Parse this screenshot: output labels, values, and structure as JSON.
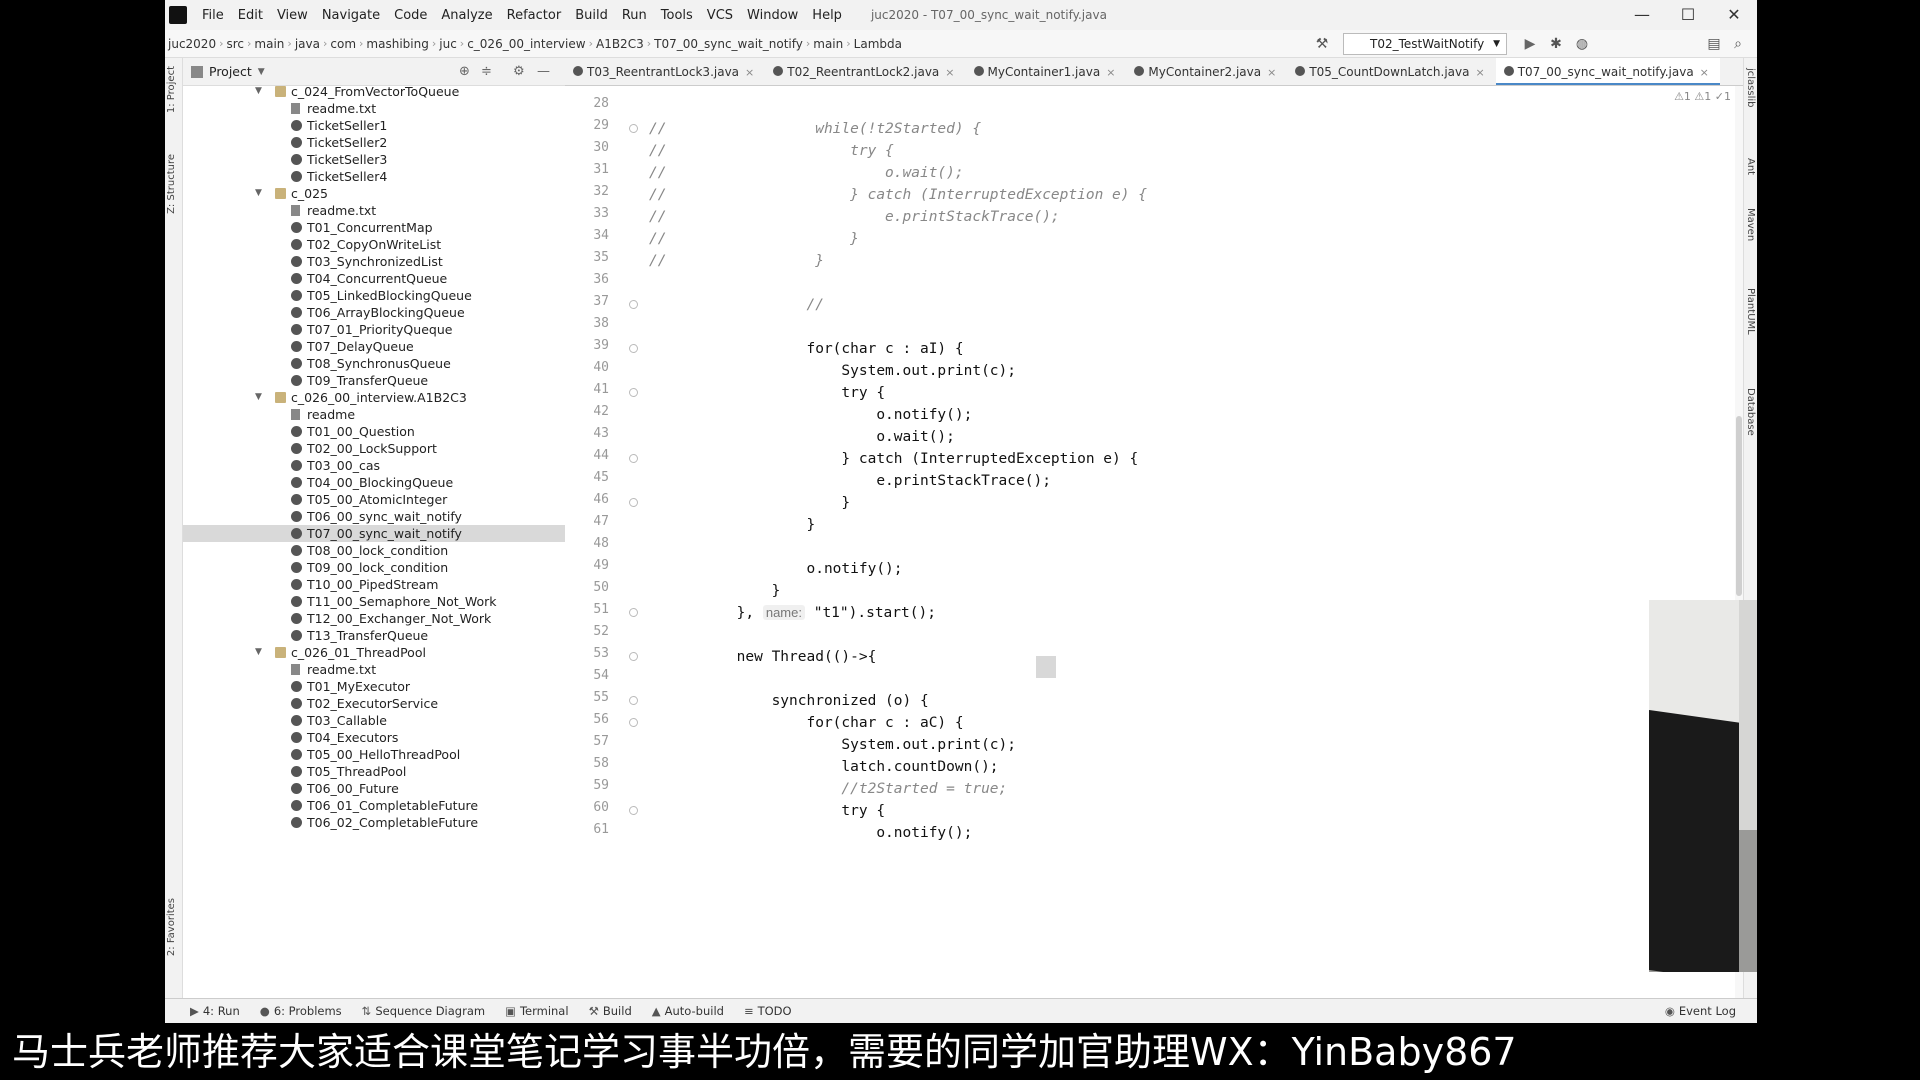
{
  "menu": {
    "items": [
      "File",
      "Edit",
      "View",
      "Navigate",
      "Code",
      "Analyze",
      "Refactor",
      "Build",
      "Run",
      "Tools",
      "VCS",
      "Window",
      "Help"
    ],
    "window_title": "juc2020 - T07_00_sync_wait_notify.java"
  },
  "window_controls": {
    "minimize": "—",
    "maximize": "☐",
    "close": "✕"
  },
  "breadcrumbs": [
    "juc2020",
    "src",
    "main",
    "java",
    "com",
    "mashibing",
    "juc",
    "c_026_00_interview",
    "A1B2C3",
    "T07_00_sync_wait_notify",
    "main",
    "Lambda"
  ],
  "run_config": "T02_TestWaitNotify",
  "project_panel": {
    "title": "Project"
  },
  "left_strip": {
    "project": "1: Project",
    "structure": "Z: Structure",
    "favorites": "2: Favorites"
  },
  "right_strip": {
    "jclasslib": "jclasslib",
    "ant": "Ant",
    "maven": "Maven",
    "plantuml": "PlantUML",
    "database": "Database"
  },
  "tree": [
    {
      "label": "c_024_FromVectorToQueue",
      "kind": "pkg",
      "depth": 1,
      "expanded": true
    },
    {
      "label": "readme.txt",
      "kind": "txt",
      "depth": 2
    },
    {
      "label": "TicketSeller1",
      "kind": "java",
      "depth": 2
    },
    {
      "label": "TicketSeller2",
      "kind": "java",
      "depth": 2
    },
    {
      "label": "TicketSeller3",
      "kind": "java",
      "depth": 2
    },
    {
      "label": "TicketSeller4",
      "kind": "java",
      "depth": 2
    },
    {
      "label": "c_025",
      "kind": "pkg",
      "depth": 1,
      "expanded": true
    },
    {
      "label": "readme.txt",
      "kind": "txt",
      "depth": 2
    },
    {
      "label": "T01_ConcurrentMap",
      "kind": "java",
      "depth": 2
    },
    {
      "label": "T02_CopyOnWriteList",
      "kind": "java",
      "depth": 2
    },
    {
      "label": "T03_SynchronizedList",
      "kind": "java",
      "depth": 2
    },
    {
      "label": "T04_ConcurrentQueue",
      "kind": "java",
      "depth": 2
    },
    {
      "label": "T05_LinkedBlockingQueue",
      "kind": "java",
      "depth": 2
    },
    {
      "label": "T06_ArrayBlockingQueue",
      "kind": "java",
      "depth": 2
    },
    {
      "label": "T07_01_PriorityQueque",
      "kind": "java",
      "depth": 2
    },
    {
      "label": "T07_DelayQueue",
      "kind": "java",
      "depth": 2
    },
    {
      "label": "T08_SynchronusQueue",
      "kind": "java",
      "depth": 2
    },
    {
      "label": "T09_TransferQueue",
      "kind": "java",
      "depth": 2
    },
    {
      "label": "c_026_00_interview.A1B2C3",
      "kind": "pkg",
      "depth": 1,
      "expanded": true
    },
    {
      "label": "readme",
      "kind": "txt",
      "depth": 2
    },
    {
      "label": "T01_00_Question",
      "kind": "java",
      "depth": 2
    },
    {
      "label": "T02_00_LockSupport",
      "kind": "java",
      "depth": 2
    },
    {
      "label": "T03_00_cas",
      "kind": "java",
      "depth": 2
    },
    {
      "label": "T04_00_BlockingQueue",
      "kind": "java",
      "depth": 2
    },
    {
      "label": "T05_00_AtomicInteger",
      "kind": "java",
      "depth": 2
    },
    {
      "label": "T06_00_sync_wait_notify",
      "kind": "java",
      "depth": 2
    },
    {
      "label": "T07_00_sync_wait_notify",
      "kind": "java",
      "depth": 2,
      "selected": true
    },
    {
      "label": "T08_00_lock_condition",
      "kind": "java",
      "depth": 2
    },
    {
      "label": "T09_00_lock_condition",
      "kind": "java",
      "depth": 2
    },
    {
      "label": "T10_00_PipedStream",
      "kind": "java",
      "depth": 2
    },
    {
      "label": "T11_00_Semaphore_Not_Work",
      "kind": "java",
      "depth": 2
    },
    {
      "label": "T12_00_Exchanger_Not_Work",
      "kind": "java",
      "depth": 2
    },
    {
      "label": "T13_TransferQueue",
      "kind": "java",
      "depth": 2
    },
    {
      "label": "c_026_01_ThreadPool",
      "kind": "pkg",
      "depth": 1,
      "expanded": true
    },
    {
      "label": "readme.txt",
      "kind": "txt",
      "depth": 2
    },
    {
      "label": "T01_MyExecutor",
      "kind": "java",
      "depth": 2
    },
    {
      "label": "T02_ExecutorService",
      "kind": "java",
      "depth": 2
    },
    {
      "label": "T03_Callable",
      "kind": "java",
      "depth": 2
    },
    {
      "label": "T04_Executors",
      "kind": "java",
      "depth": 2
    },
    {
      "label": "T05_00_HelloThreadPool",
      "kind": "java",
      "depth": 2
    },
    {
      "label": "T05_ThreadPool",
      "kind": "java",
      "depth": 2
    },
    {
      "label": "T06_00_Future",
      "kind": "java",
      "depth": 2
    },
    {
      "label": "T06_01_CompletableFuture",
      "kind": "java",
      "depth": 2
    },
    {
      "label": "T06_02_CompletableFuture",
      "kind": "java",
      "depth": 2
    }
  ],
  "editor_tabs": [
    {
      "label": "T03_ReentrantLock3.java"
    },
    {
      "label": "T02_ReentrantLock2.java"
    },
    {
      "label": "MyContainer1.java"
    },
    {
      "label": "MyContainer2.java"
    },
    {
      "label": "T05_CountDownLatch.java"
    },
    {
      "label": "T07_00_sync_wait_notify.java",
      "active": true
    }
  ],
  "inspection": "⚠1 ⚠1 ✓1",
  "code": [
    {
      "n": "28",
      "text": ""
    },
    {
      "n": "29",
      "text": "              while(!t2Started) {",
      "comment": true
    },
    {
      "n": "30",
      "text": "                  try {",
      "comment": true
    },
    {
      "n": "31",
      "text": "                      o.wait();",
      "comment": true
    },
    {
      "n": "32",
      "text": "                  } catch (InterruptedException e) {",
      "comment": true
    },
    {
      "n": "33",
      "text": "                      e.printStackTrace();",
      "comment": true
    },
    {
      "n": "34",
      "text": "                  }",
      "comment": true
    },
    {
      "n": "35",
      "text": "              }",
      "comment": true
    },
    {
      "n": "36",
      "text": ""
    },
    {
      "n": "37",
      "text": "             //",
      "comment": true,
      "nomark": true
    },
    {
      "n": "38",
      "text": ""
    },
    {
      "n": "39",
      "text": "             for(char c : aI) {"
    },
    {
      "n": "40",
      "text": "                 System.out.print(c);"
    },
    {
      "n": "41",
      "text": "                 try {"
    },
    {
      "n": "42",
      "text": "                     o.notify();"
    },
    {
      "n": "43",
      "text": "                     o.wait();"
    },
    {
      "n": "44",
      "text": "                 } catch (InterruptedException e) {"
    },
    {
      "n": "45",
      "text": "                     e.printStackTrace();"
    },
    {
      "n": "46",
      "text": "                 }"
    },
    {
      "n": "47",
      "text": "             }"
    },
    {
      "n": "48",
      "text": ""
    },
    {
      "n": "49",
      "text": "             o.notify();"
    },
    {
      "n": "50",
      "text": "         }"
    },
    {
      "n": "51",
      "text": "     }, ",
      "hint": "name:",
      "tail": " \"t1\").start();"
    },
    {
      "n": "52",
      "text": ""
    },
    {
      "n": "53",
      "text": "     new Thread(()->{"
    },
    {
      "n": "54",
      "text": ""
    },
    {
      "n": "55",
      "text": "         synchronized (o) {"
    },
    {
      "n": "56",
      "text": "             for(char c : aC) {"
    },
    {
      "n": "57",
      "text": "                 System.out.print(c);"
    },
    {
      "n": "58",
      "text": "                 latch.countDown();"
    },
    {
      "n": "59",
      "text": "                 //t2Started = true;",
      "comment": true,
      "nomark": true
    },
    {
      "n": "60",
      "text": "                 try {"
    },
    {
      "n": "61",
      "text": "                     o.notify();"
    }
  ],
  "bottom_tools": [
    {
      "icon": "▶",
      "label": "4: Run"
    },
    {
      "icon": "●",
      "label": "6: Problems"
    },
    {
      "icon": "⇅",
      "label": "Sequence Diagram"
    },
    {
      "icon": "▣",
      "label": "Terminal"
    },
    {
      "icon": "⚒",
      "label": "Build"
    },
    {
      "icon": "▲",
      "label": "Auto-build"
    },
    {
      "icon": "≡",
      "label": "TODO"
    }
  ],
  "event_log": "Event Log",
  "watermark": "马士兵老师推荐大家适合课堂笔记学习事半功倍，需要的同学加官助理WX：YinBaby867"
}
